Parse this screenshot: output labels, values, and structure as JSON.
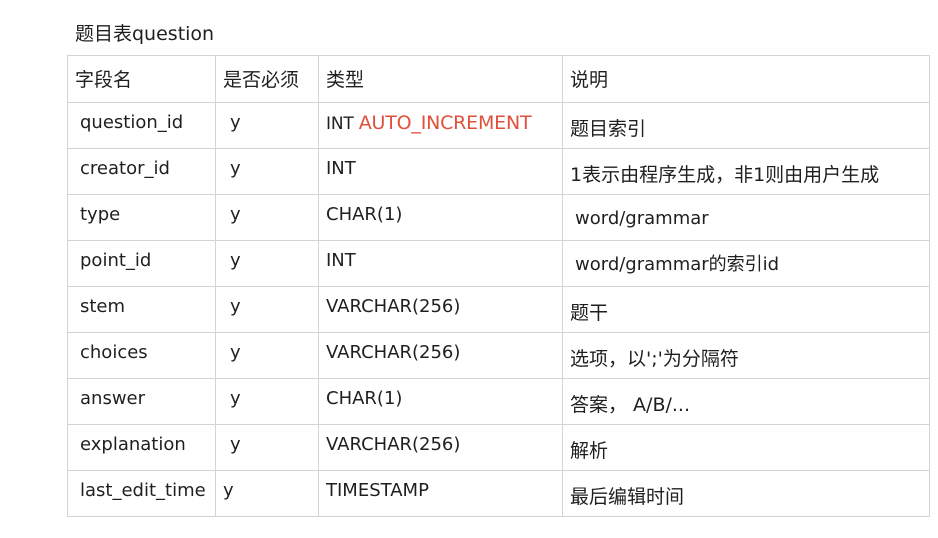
{
  "title": "题目表question",
  "headers": {
    "field": "字段名",
    "required": "是否必须",
    "type": "类型",
    "description": "说明"
  },
  "rows": [
    {
      "field": "question_id",
      "required": "y",
      "type": "INT",
      "type_extra": "AUTO_INCREMENT",
      "description": "题目索引"
    },
    {
      "field": "creator_id",
      "required": "y",
      "type": "INT",
      "description": "1表示由程序生成，非1则由用户生成"
    },
    {
      "field": "type",
      "required": "y",
      "type": "CHAR(1)",
      "description": "word/grammar"
    },
    {
      "field": "point_id",
      "required": "y",
      "type": "INT",
      "description": "word/grammar的索引id"
    },
    {
      "field": "stem",
      "required": "y",
      "type": "VARCHAR(256)",
      "description": "题干"
    },
    {
      "field": "choices",
      "required": "y",
      "type": "VARCHAR(256)",
      "description": "选项，以';'为分隔符"
    },
    {
      "field": "answer",
      "required": "y",
      "type": "CHAR(1)",
      "description": "答案， A/B/..."
    },
    {
      "field": "explanation",
      "required": "y",
      "type": "VARCHAR(256)",
      "description": "解析"
    },
    {
      "field": "last_edit_time",
      "required": "y",
      "type": "TIMESTAMP",
      "description": "最后编辑时间"
    }
  ],
  "colors": {
    "accent_text": "#e0503a",
    "border": "#d4d4d4"
  }
}
